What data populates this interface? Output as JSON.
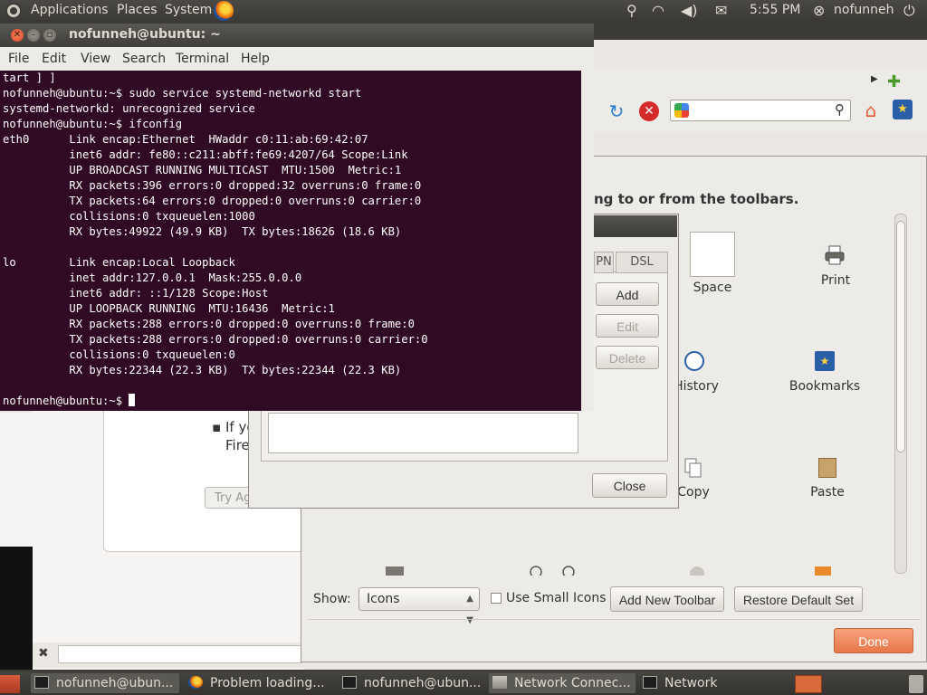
{
  "top_panel": {
    "menus": [
      "Applications",
      "Places",
      "System"
    ],
    "clock": "5:55 PM",
    "user": "nofunneh"
  },
  "terminal": {
    "title": "nofunneh@ubuntu: ~",
    "menus": [
      "File",
      "Edit",
      "View",
      "Search",
      "Terminal",
      "Help"
    ],
    "lines": [
      "tart ] ]",
      "nofunneh@ubuntu:~$ sudo service systemd-networkd start",
      "systemd-networkd: unrecognized service",
      "nofunneh@ubuntu:~$ ifconfig",
      "eth0      Link encap:Ethernet  HWaddr c0:11:ab:69:42:07",
      "          inet6 addr: fe80::c211:abff:fe69:4207/64 Scope:Link",
      "          UP BROADCAST RUNNING MULTICAST  MTU:1500  Metric:1",
      "          RX packets:396 errors:0 dropped:32 overruns:0 frame:0",
      "          TX packets:64 errors:0 dropped:0 overruns:0 carrier:0",
      "          collisions:0 txqueuelen:1000",
      "          RX bytes:49922 (49.9 KB)  TX bytes:18626 (18.6 KB)",
      "",
      "lo        Link encap:Local Loopback",
      "          inet addr:127.0.0.1  Mask:255.0.0.0",
      "          inet6 addr: ::1/128 Scope:Host",
      "          UP LOOPBACK RUNNING  MTU:16436  Metric:1",
      "          RX packets:288 errors:0 dropped:0 overruns:0 frame:0",
      "          TX packets:288 errors:0 dropped:0 overruns:0 carrier:0",
      "          collisions:0 txqueuelen:0",
      "          RX bytes:22344 (22.3 KB)  TX bytes:22344 (22.3 KB)",
      ""
    ],
    "prompt": "nofunneh@ubuntu:~$ "
  },
  "firefox": {
    "page_text_line1": "If yo",
    "page_text_line2": "Fire",
    "try_again_button": "Try Ag"
  },
  "customize_toolbar": {
    "description": "ng to or from the toolbars.",
    "items": {
      "space": "Space",
      "print": "Print",
      "history": "History",
      "bookmarks": "Bookmarks",
      "copy": "Copy",
      "paste": "Paste"
    },
    "show_label": "Show:",
    "show_value": "Icons",
    "small_icons_label": "Use Small Icons",
    "add_toolbar_button": "Add New Toolbar",
    "restore_button": "Restore Default Set",
    "done_button": "Done"
  },
  "network_connections": {
    "tabs": [
      "PN",
      "DSL"
    ],
    "add_button": "Add",
    "edit_button": "Edit",
    "delete_button": "Delete",
    "close_button": "Close"
  },
  "taskbar": {
    "items": [
      {
        "label": "nofunneh@ubun...",
        "icon": "terminal-icon"
      },
      {
        "label": "Problem loading...",
        "icon": "firefox-icon"
      },
      {
        "label": "nofunneh@ubun...",
        "icon": "terminal-icon"
      },
      {
        "label": "Network Connec...",
        "icon": "network-icon"
      },
      {
        "label": "Network",
        "icon": "terminal-icon"
      }
    ]
  }
}
